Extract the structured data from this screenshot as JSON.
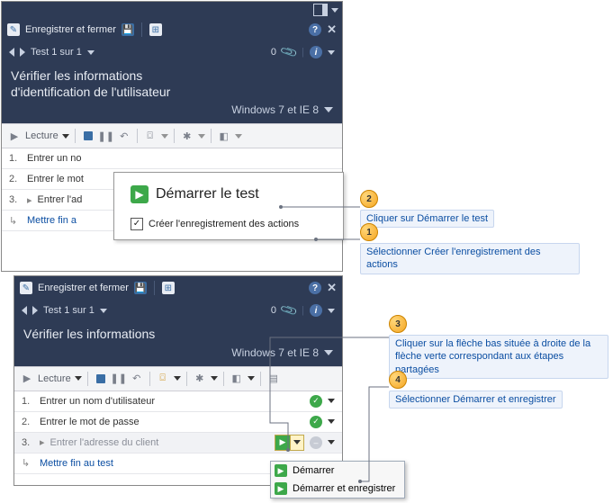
{
  "window1": {
    "save_close_label": "Enregistrer et fermer",
    "test_counter": "Test 1 sur 1",
    "attach_count": "0",
    "title_line1": "Vérifier les informations",
    "title_line2": "d'identification de l'utilisateur",
    "env_text": "Windows 7 et IE 8",
    "toolbar_mode": "Lecture",
    "steps": [
      {
        "num": "1.",
        "text": "Entrer un no"
      },
      {
        "num": "2.",
        "text": "Entrer le mot"
      },
      {
        "num": "3.",
        "text": "Entrer l'ad",
        "prefix": "▸"
      }
    ],
    "end_link": "Mettre fin a"
  },
  "overlay": {
    "start_label": "Démarrer le test",
    "checkbox_label": "Créer l'enregistrement des actions",
    "checked": true
  },
  "window2": {
    "save_close_label": "Enregistrer et fermer",
    "test_counter": "Test 1 sur 1",
    "attach_count": "0",
    "title_line1": "Vérifier les informations",
    "env_text": "Windows 7 et IE 8",
    "toolbar_mode": "Lecture",
    "steps": [
      {
        "num": "1.",
        "text": "Entrer un nom d'utilisateur",
        "status": "green"
      },
      {
        "num": "2.",
        "text": "Entrer le mot de passe",
        "status": "green"
      },
      {
        "num": "3.",
        "text": "Entrer l'adresse du client",
        "dim": true,
        "split": true
      }
    ],
    "end_link": "Mettre fin au test"
  },
  "menu": {
    "item1": "Démarrer",
    "item2": "Démarrer et enregistrer"
  },
  "callouts": {
    "c1": "Sélectionner Créer l'enregistrement des actions",
    "c2": "Cliquer sur Démarrer le test",
    "c3": "Cliquer sur la flèche bas située à droite de la flèche verte correspondant aux étapes partagées",
    "c4": "Sélectionner Démarrer et enregistrer"
  }
}
